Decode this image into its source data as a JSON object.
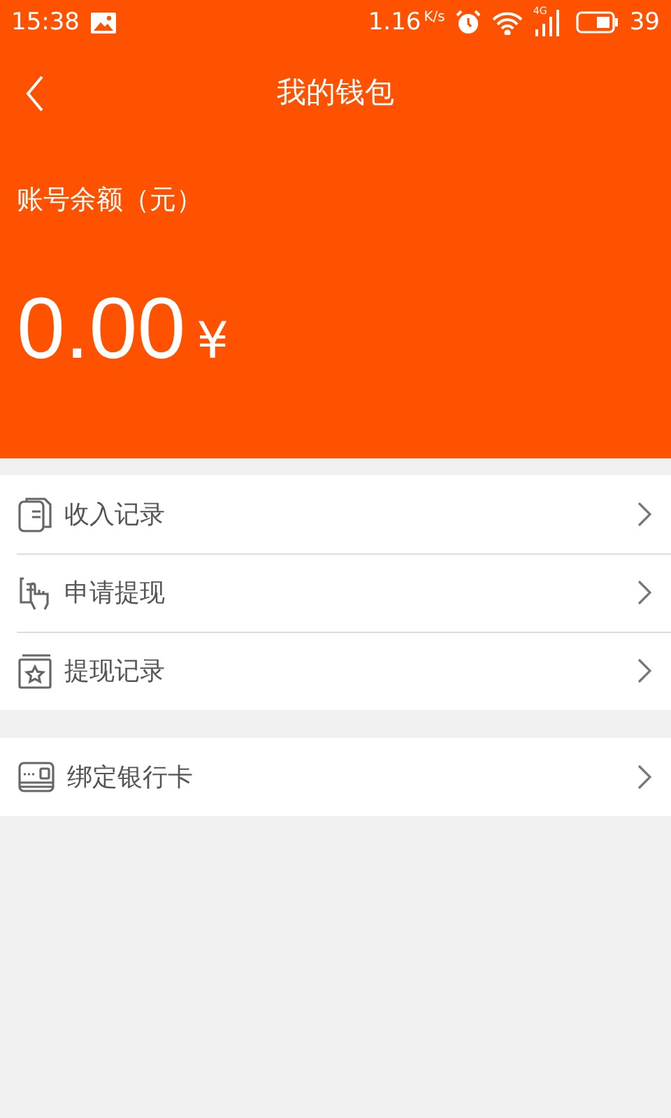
{
  "status_bar": {
    "time": "15:38",
    "speed": "1.16",
    "speed_unit": "K/s",
    "network": "4G",
    "battery": "39"
  },
  "header": {
    "title": "我的钱包"
  },
  "balance": {
    "label": "账号余额（元）",
    "amount": "0.00",
    "currency": "¥"
  },
  "menu_groups": [
    {
      "items": [
        {
          "kind": "income",
          "label": "收入记录"
        },
        {
          "kind": "withdraw",
          "label": "申请提现"
        },
        {
          "kind": "history",
          "label": "提现记录"
        }
      ]
    },
    {
      "items": [
        {
          "kind": "card",
          "label": "绑定银行卡"
        }
      ]
    }
  ]
}
